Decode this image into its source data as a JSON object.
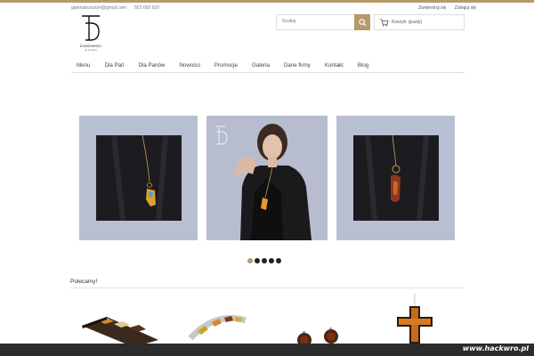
{
  "header": {
    "email": "galeriabursztyn@gmail.com",
    "phone": "501 692 620",
    "register_label": "Zarejestruj się",
    "login_label": "Zaloguj się",
    "logo_text": "DOMOWSKI",
    "logo_sub": "art jewellery"
  },
  "search": {
    "placeholder": "Szukaj"
  },
  "cart": {
    "label": "Koszyk: (pusty)"
  },
  "nav": {
    "items": [
      {
        "label": "Menu"
      },
      {
        "label": "Dla Pań"
      },
      {
        "label": "Dla Panów"
      },
      {
        "label": "Nowości"
      },
      {
        "label": "Promocje"
      },
      {
        "label": "Galeria"
      },
      {
        "label": "Dane firmy"
      },
      {
        "label": "Kontakt"
      },
      {
        "label": "Blog"
      }
    ]
  },
  "slider": {
    "slide_count": 5,
    "active_index": 0
  },
  "featured": {
    "title": "Polecamy!"
  },
  "watermark": {
    "text": "www.hackwro.pl"
  },
  "colors": {
    "accent": "#b59a6a",
    "slide_bg": "#b9bfd2",
    "dark": "#1b1a1e"
  }
}
